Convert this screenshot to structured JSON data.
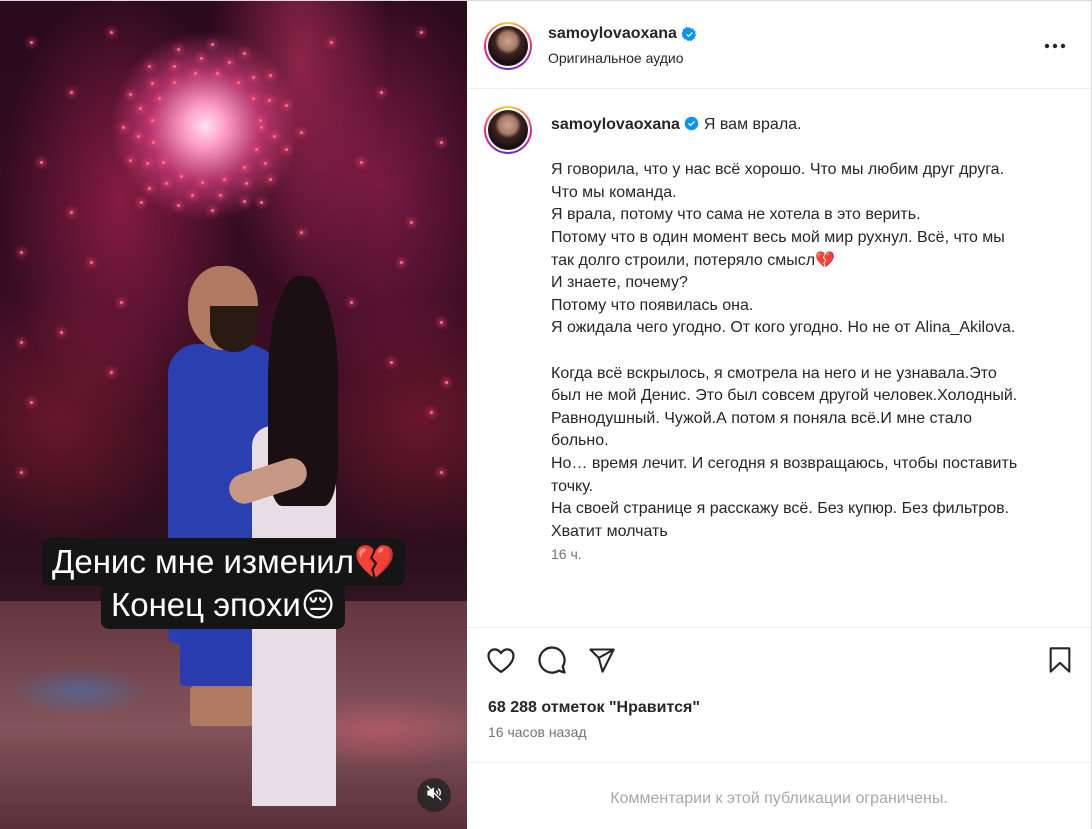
{
  "media": {
    "overlay_line1": "Денис мне изменил💔",
    "overlay_line2": "Конец эпохи😔",
    "mute_icon": "speaker-muted-icon"
  },
  "header": {
    "username": "samoylovaoxana",
    "subtitle": "Оригинальное аудио",
    "verified_icon": "verified-badge-icon",
    "more_icon": "more-horizontal-icon"
  },
  "caption": {
    "username": "samoylovaoxana",
    "first_line": "Я вам врала.",
    "lines": [
      "",
      "Я говорила, что у нас всё хорошо. Что мы любим друг друга.",
      "Что мы команда.",
      "Я врала, потому что сама не хотела в это верить.",
      "Потому что в один момент весь мой мир рухнул. Всё, что мы",
      "так долго строили, потеряло смысл💔",
      "И знаете, почему?",
      "Потому что появилась она.",
      "Я ожидала чего угодно. От кого угодно. Но не от Alina_Akilova.",
      "",
      "Когда всё вскрылось, я смотрела на него и не узнавала.Это",
      "был не мой Денис. Это был совсем другой человек.Холодный.",
      "Равнодушный. Чужой.А потом я поняла всё.И мне стало",
      "больно.",
      "Но… время лечит. И сегодня я возвращаюсь, чтобы поставить",
      "точку.",
      "На своей странице я расскажу всё. Без купюр. Без фильтров.",
      "Хватит молчать"
    ],
    "time": "16 ч."
  },
  "actions": {
    "like_icon": "heart-icon",
    "comment_icon": "comment-icon",
    "share_icon": "share-icon",
    "save_icon": "bookmark-icon",
    "likes_text": "68 288 отметок \"Нравится\"",
    "posted": "16 часов назад"
  },
  "comments": {
    "restricted_text": "Комментарии к этой публикации ограничены."
  },
  "colors": {
    "verified_blue": "#0095f6",
    "muted_text": "#737373",
    "disabled_text": "#a8a8a8",
    "divider": "#efefef"
  }
}
